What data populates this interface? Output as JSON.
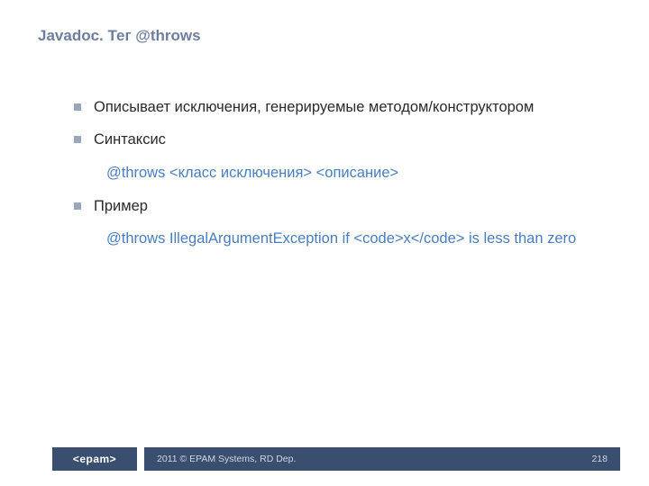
{
  "title": "Javadoc. Тег @throws",
  "bullets": [
    {
      "text": "Описывает исключения, генерируемые методом/конструктором",
      "sub": null
    },
    {
      "text": "Синтаксис",
      "sub": "@throws <класс исключения> <описание>"
    },
    {
      "text": "Пример",
      "sub": "@throws IllegalArgumentException if <code>x</code> is less than zero"
    }
  ],
  "footer": {
    "logo": "<epam>",
    "copyright": "2011 © EPAM Systems, RD Dep.",
    "page": "218"
  }
}
